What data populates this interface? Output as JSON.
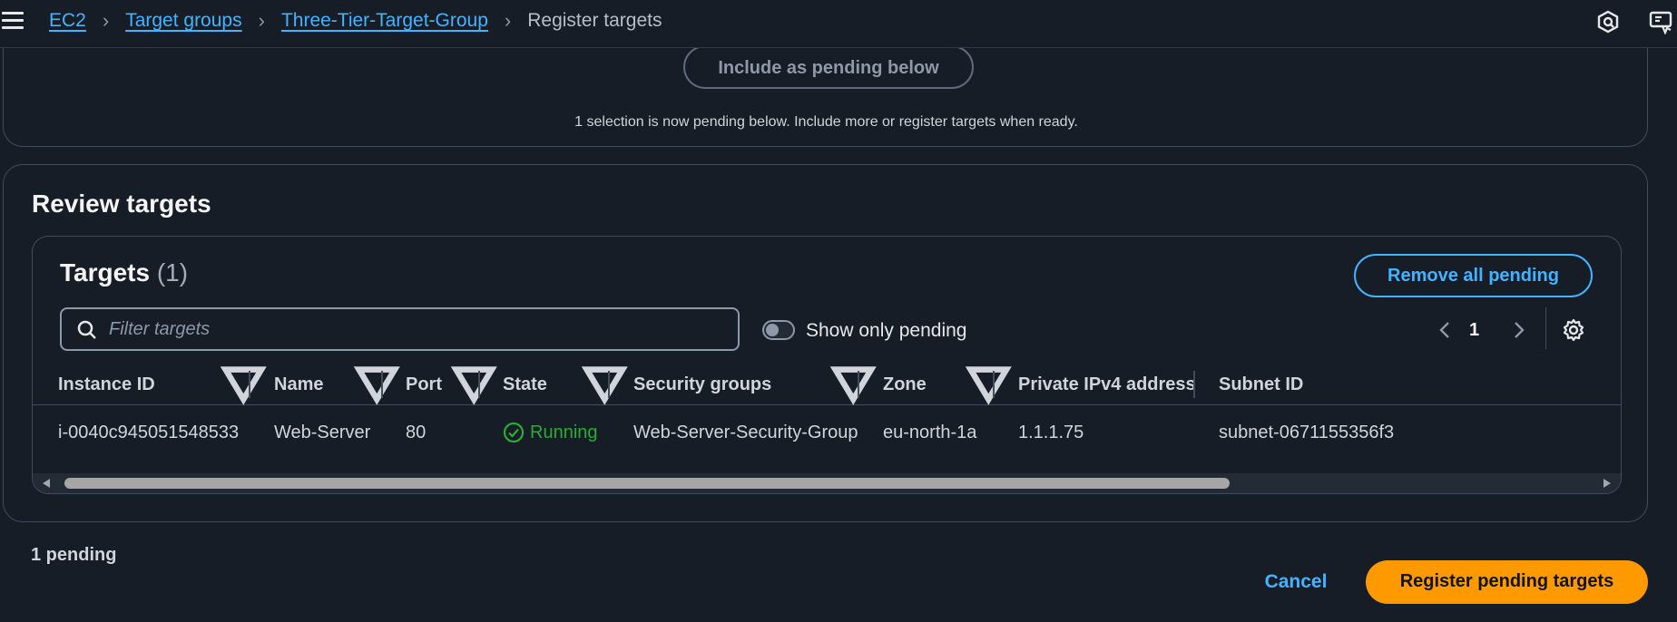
{
  "breadcrumb": {
    "items": [
      "EC2",
      "Target groups",
      "Three-Tier-Target-Group"
    ],
    "current": "Register targets"
  },
  "upper": {
    "include_button": "Include as pending below",
    "selection_message": "1 selection is now pending below. Include more or register targets when ready."
  },
  "review": {
    "title": "Review targets",
    "targets_title": "Targets",
    "targets_count": "(1)",
    "remove_all_label": "Remove all pending",
    "filter_placeholder": "Filter targets",
    "toggle_label": "Show only pending",
    "page_number": "1",
    "columns": [
      "Instance ID",
      "Name",
      "Port",
      "State",
      "Security groups",
      "Zone",
      "Private IPv4 address",
      "Subnet ID"
    ],
    "rows": [
      {
        "instance_id": "i-0040c945051548533",
        "name": "Web-Server",
        "port": "80",
        "state": "Running",
        "security_group": "Web-Server-Security-Group",
        "zone": "eu-north-1a",
        "ipv4": "1.1.1.75",
        "subnet": "subnet-0671155356f3"
      }
    ]
  },
  "footer": {
    "pending_count": "1 pending",
    "cancel_label": "Cancel",
    "register_label": "Register pending targets"
  },
  "colors": {
    "background": "#161d26",
    "link": "#42b4ff",
    "primary_button": "#ff9900",
    "running": "#29ad32"
  }
}
